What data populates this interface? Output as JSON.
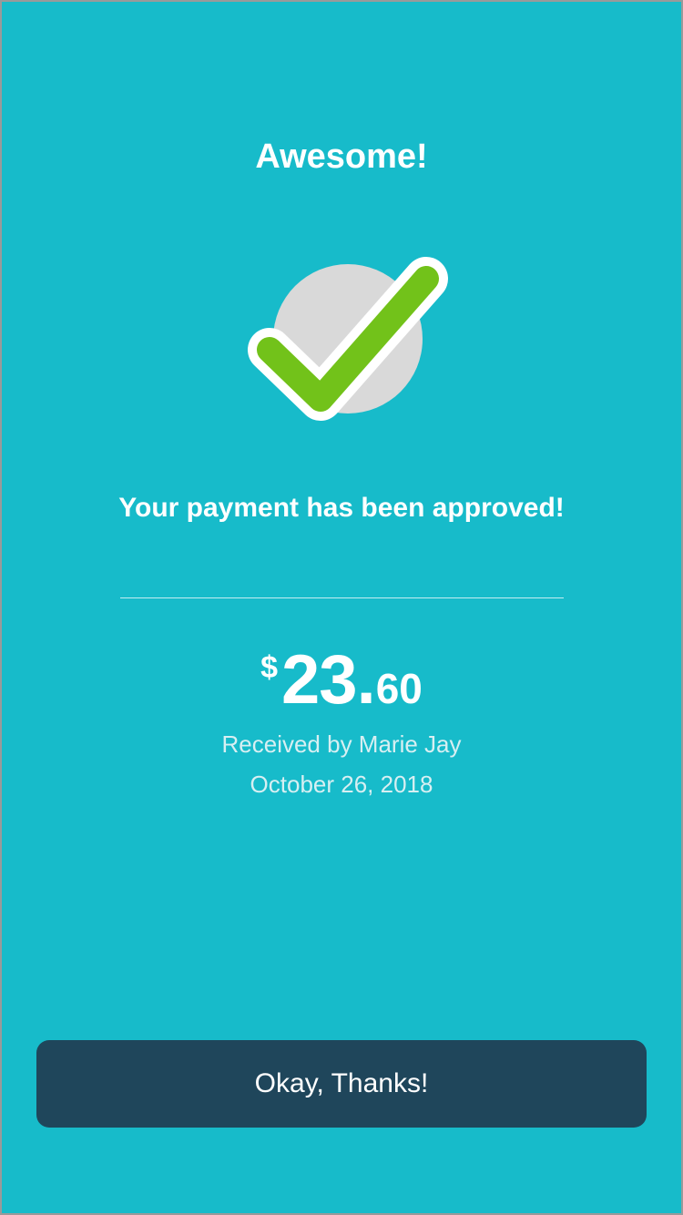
{
  "header": {
    "title": "Awesome!"
  },
  "status": {
    "icon": "check-icon",
    "message": "Your payment has been approved!"
  },
  "payment": {
    "currency_symbol": "$",
    "amount_whole": "23",
    "amount_decimal_point": ".",
    "amount_cents": "60",
    "received_by": "Received by Marie Jay",
    "date": "October 26, 2018"
  },
  "actions": {
    "confirm_label": "Okay, Thanks!"
  },
  "colors": {
    "background": "#17bbca",
    "check": "#72c21a",
    "circle": "#d9d9d9",
    "button": "#1f465b",
    "text": "#ffffff",
    "secondary_text": "#d7eff2"
  }
}
